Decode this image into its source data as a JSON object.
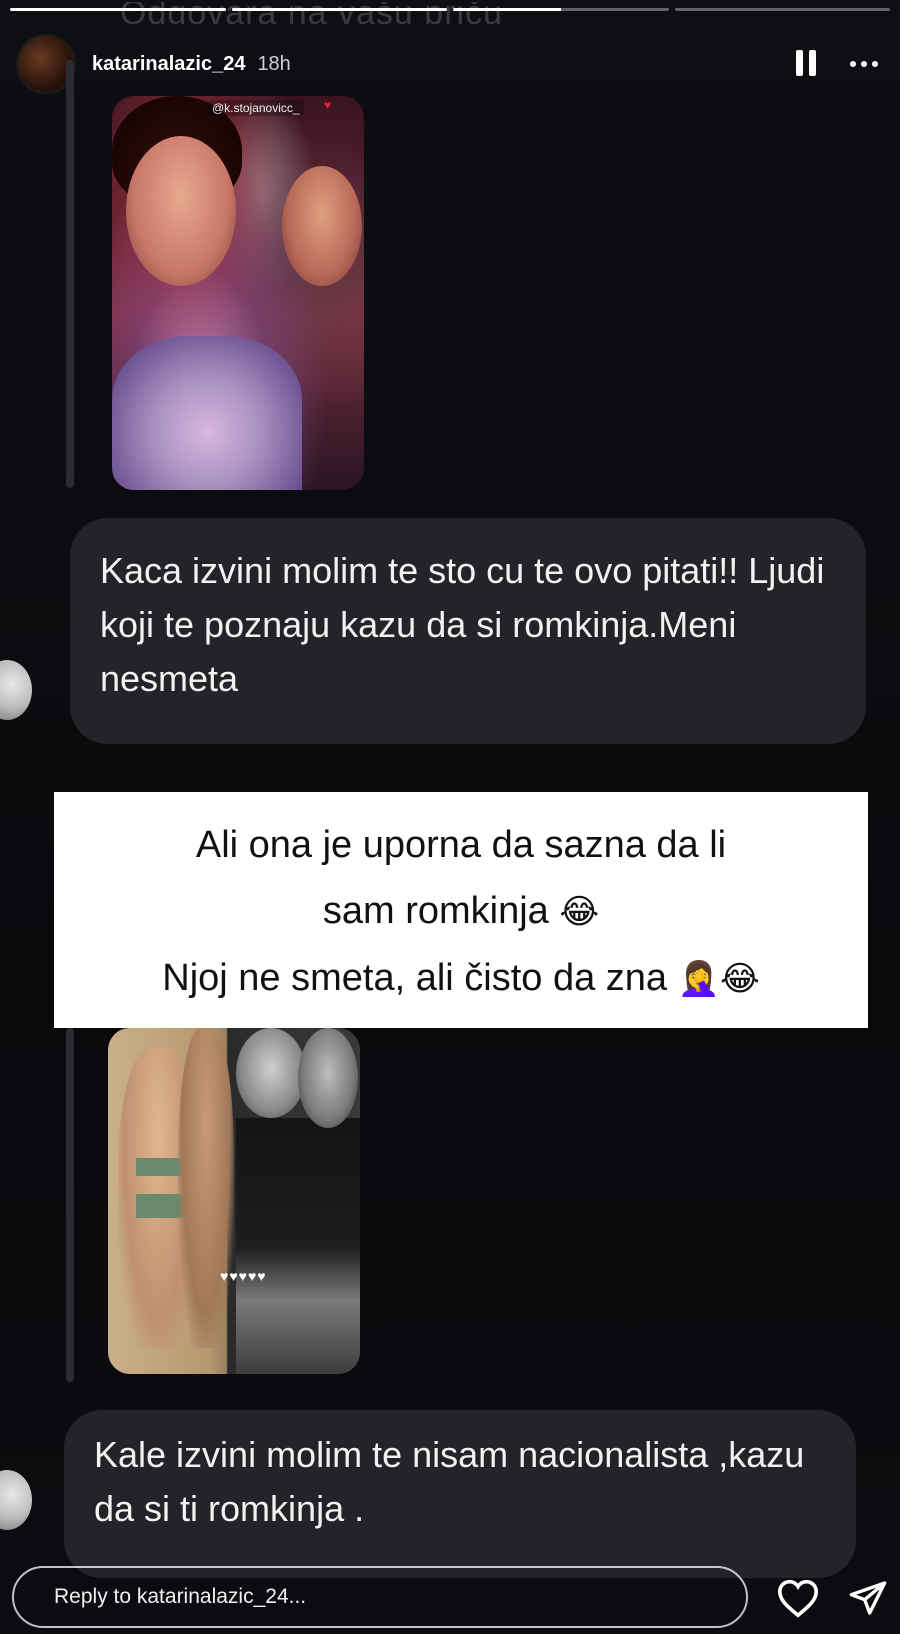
{
  "story": {
    "faded_top_text": "Odgovara na vašu priču",
    "progress": [
      1,
      1,
      0.5,
      0
    ],
    "user": {
      "username": "katarinalazic_24",
      "time": "18h"
    }
  },
  "photo1": {
    "mention_tag": "@k.stojanovicc_",
    "heart": "♥"
  },
  "photo2": {
    "hearts": "♥♥♥♥♥"
  },
  "messages": {
    "first": "Kaca izvini molim te sto cu te ovo pitati!! Ljudi koji te poznaju kazu da si romkinja.Meni nesmeta",
    "second": "Kale izvini molim te nisam nacionalista ,kazu da si ti romkinja ."
  },
  "caption": {
    "line1": "Ali ona je uporna da sazna da li",
    "line2": "sam romkinja",
    "line2_emoji": "😂",
    "line3": "Njoj ne smeta, ali čisto da zna",
    "line3_emoji1": "🤦‍♀️",
    "line3_emoji2": "😂"
  },
  "reply": {
    "placeholder": "Reply to katarinalazic_24..."
  },
  "icons": {
    "pause": "pause-icon",
    "more": "more-icon",
    "heart": "heart-icon",
    "send": "send-icon"
  }
}
